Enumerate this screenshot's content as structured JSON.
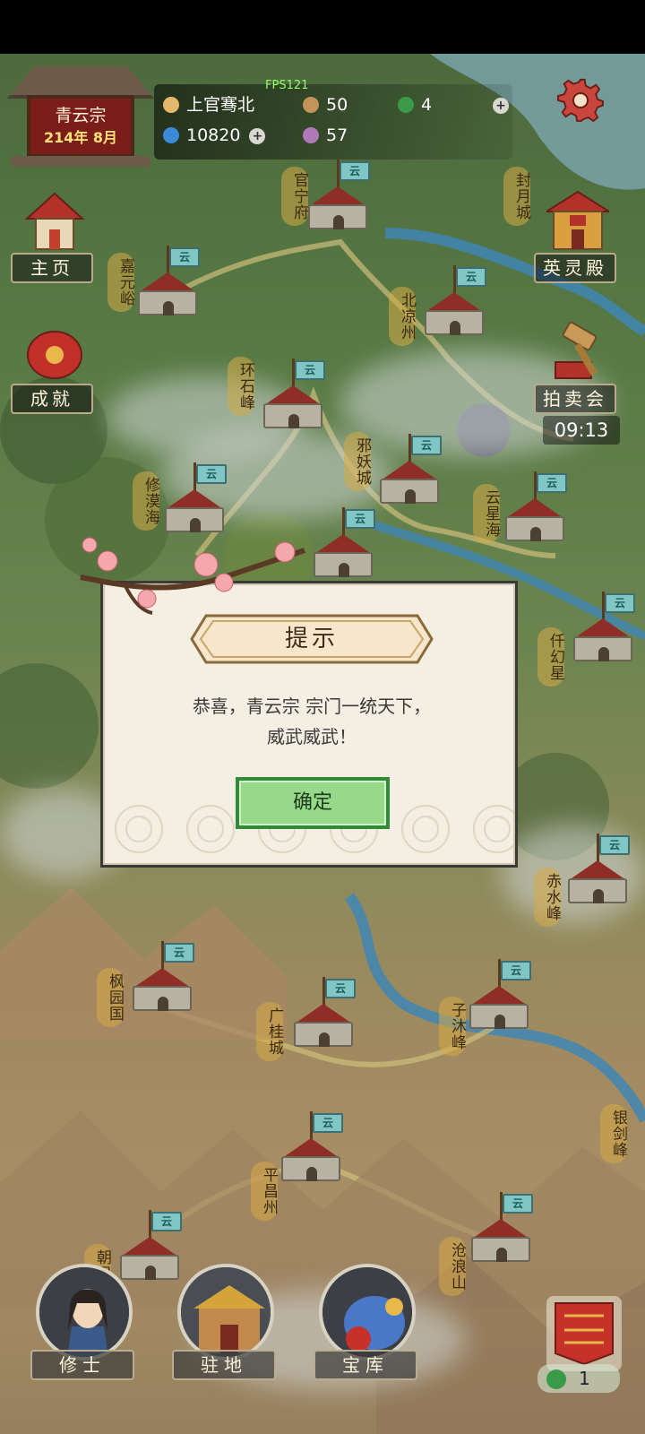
{
  "header": {
    "sect_name": "青云宗",
    "date": "214年 8月",
    "fps": "FPS121",
    "player_name": "上官骞北",
    "stat_people": "50",
    "stat_jade": "4",
    "spirit_stones": "10820",
    "stat_disciples": "57"
  },
  "side_menu": {
    "home": "主页",
    "achievements": "成就",
    "hero_hall": "英灵殿",
    "auction": "拍卖会",
    "auction_timer": "09:13"
  },
  "map_labels": {
    "guanning": "官宁府",
    "fengyue": "封月城",
    "jiayuan": "嘉元峪",
    "beiliang": "北凉州",
    "huanshi": "环石峰",
    "xieyao": "邪妖城",
    "xiumo": "修漠海",
    "yunxing": "云星海",
    "qianhuan": "仟幻星",
    "chishui": "赤水峰",
    "fengyuan": "枫园国",
    "guanggui": "广桂城",
    "zimu": "子沐峰",
    "yinjian": "银剑峰",
    "pingchang": "平昌州",
    "chaofeng": "朝凤山",
    "canglang": "沧浪山"
  },
  "flag_glyph": "云",
  "dialog": {
    "title": "提示",
    "message_line1": "恭喜，青云宗 宗门一统天下，",
    "message_line2": "威武威武！",
    "confirm": "确定"
  },
  "bottom_nav": {
    "cultivators": "修士",
    "station": "驻地",
    "treasury": "宝库",
    "banner_count": "1"
  },
  "colors": {
    "dialog_bg": "#f4efe2",
    "confirm_bg": "#96d98a",
    "confirm_border": "#2f8a3a",
    "flag": "#7fc6c4",
    "date": "#ffe27a",
    "fps": "#8fff6b"
  },
  "icons": [
    "user-icon",
    "population-icon",
    "jade-icon",
    "spirit-stone-icon",
    "disciple-icon",
    "plus-icon",
    "gear-icon",
    "flag-icon"
  ]
}
